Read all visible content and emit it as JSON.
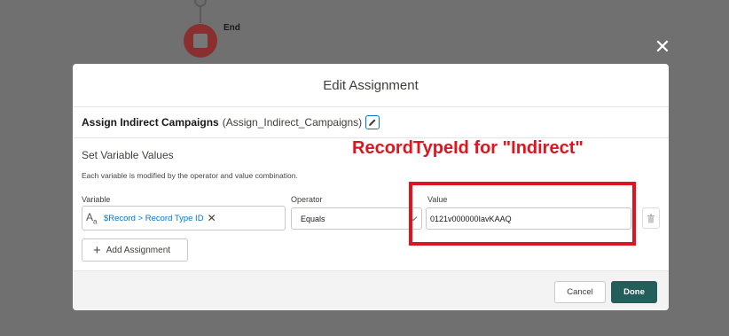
{
  "canvas": {
    "end_label": "End"
  },
  "modal": {
    "title": "Edit Assignment",
    "element_name": "Assign Indirect Campaigns",
    "element_api_name": "(Assign_Indirect_Campaigns)",
    "section_title": "Set Variable Values",
    "section_description": "Each variable is modified by the operator and value combination.",
    "row": {
      "variable_label": "Variable",
      "variable_value": "$Record > Record Type ID",
      "operator_label": "Operator",
      "operator_value": "Equals",
      "value_label": "Value",
      "value_value": "0121v000000IavKAAQ"
    },
    "add_assignment_label": "Add Assignment",
    "cancel_label": "Cancel",
    "done_label": "Done"
  },
  "annotation": {
    "text": "RecordTypeId for \"Indirect\"",
    "color": "#e0141e"
  },
  "colors": {
    "done_button": "#245e5a",
    "link_blue": "#0176d3",
    "end_node": "#8a2f2f"
  },
  "icons": [
    "close-icon",
    "edit-pencil-icon",
    "text-variable-icon",
    "remove-pill-icon",
    "chevron-down-icon",
    "trash-icon",
    "plus-icon"
  ]
}
